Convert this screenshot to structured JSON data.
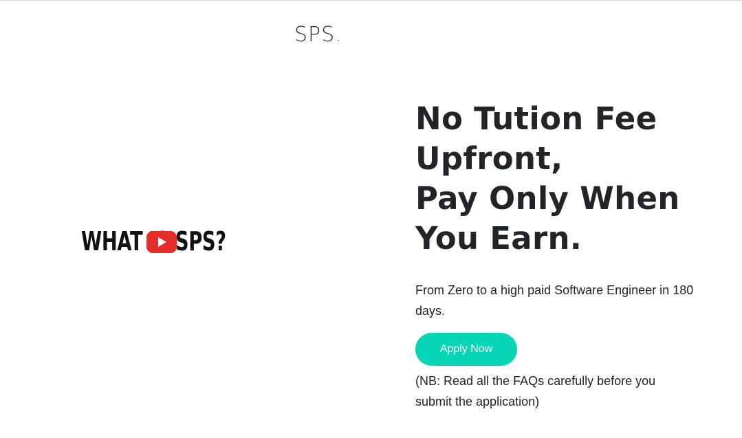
{
  "header": {
    "logo_text": "SPS",
    "logo_dot": "."
  },
  "video": {
    "thumbnail_text": "WHAT IS SPS?",
    "play_icon": "youtube-play-icon"
  },
  "hero": {
    "title_lines": [
      "No Tution Fee",
      "Upfront,",
      "Pay Only When",
      "You Earn."
    ],
    "subtitle": "From Zero to a high paid Software Engineer in 180 days.",
    "apply_label": "Apply Now",
    "note": "(NB: Read all the FAQs carefully before you submit the application)"
  },
  "colors": {
    "accent": "#07d6b6",
    "logo_dot": "#17b3cf",
    "youtube_red": "#e52d27",
    "text": "#212529"
  }
}
